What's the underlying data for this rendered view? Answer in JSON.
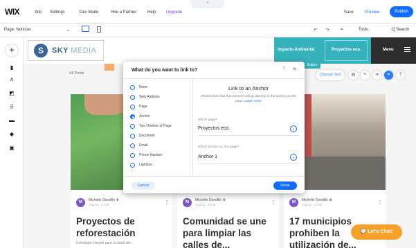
{
  "topbar": {
    "logo": "WIX",
    "menu": [
      "Site",
      "Settings",
      "Dev Mode",
      "Hire a Partner",
      "Help",
      "Upgrade"
    ],
    "handle": "˄",
    "save": "Save",
    "preview": "Preview",
    "publish": "Publish"
  },
  "subbar": {
    "page": "Page: Noticias",
    "chevron": "⌄",
    "undo": "↶",
    "redo": "↷",
    "zoom": "⌗",
    "tools": "Tools",
    "search": "Q  Search"
  },
  "rail": {
    "add": "+",
    "icons": [
      "page-icon",
      "text-icon",
      "media-icon",
      "apps-icon",
      "image-icon",
      "design-icon",
      "store-icon"
    ]
  },
  "site": {
    "brand_mark": "S",
    "brand_bold": "SKY",
    "brand_light": " MEDIA",
    "nav": [
      "Impacto Ambiental",
      "Proyectos eco."
    ],
    "menu_label": "Menu",
    "nav_tag": "Button",
    "all_posts": "All Posts",
    "change_text": "Change Text",
    "chat": "Let's Chat!"
  },
  "posts": [
    {
      "author": "Michelle Gondillo ♛",
      "date": "Aug 21 · 1 min",
      "title": "Proyectos de reforestación",
      "excerpt": "Estrategia integral para la salud del..."
    },
    {
      "author": "Michelle Gondillo ♛",
      "date": "Aug 21 · 2 min",
      "title": "Comunidad se une para limpiar las calles de...",
      "excerpt": ""
    },
    {
      "author": "Michelle Gondillo ♛",
      "date": "Aug 21 · 1 min",
      "title": "17 municipios prohiben la utilización de...",
      "excerpt": ""
    }
  ],
  "dialog": {
    "title": "What do you want to link to?",
    "help": "?",
    "close": "×",
    "options": [
      {
        "label": "None",
        "selected": false
      },
      {
        "label": "Web Address",
        "selected": false
      },
      {
        "label": "Page",
        "selected": false
      },
      {
        "label": "Anchor",
        "selected": true
      },
      {
        "label": "Top / Bottom of Page",
        "selected": false
      },
      {
        "label": "Document",
        "selected": false
      },
      {
        "label": "Email",
        "selected": false
      },
      {
        "label": "Phone Number",
        "selected": false
      },
      {
        "label": "Lightbox",
        "selected": false
      }
    ],
    "panel_title": "Link to an Anchor",
    "panel_desc": "Visitors that click this element will go directly to the anchor on the page.",
    "learn_more": "Learn more",
    "page_label": "Which page?",
    "page_value": "Proyectos eco.",
    "anchor_label": "Which anchor on this page?",
    "anchor_value": "Anchor 1",
    "cancel": "Cancel",
    "done": "Done"
  },
  "colors": {
    "accent": "#116dff",
    "teal": "#1aa8b3",
    "chat": "#f7a12a",
    "avatar": "#6a3fbf"
  }
}
